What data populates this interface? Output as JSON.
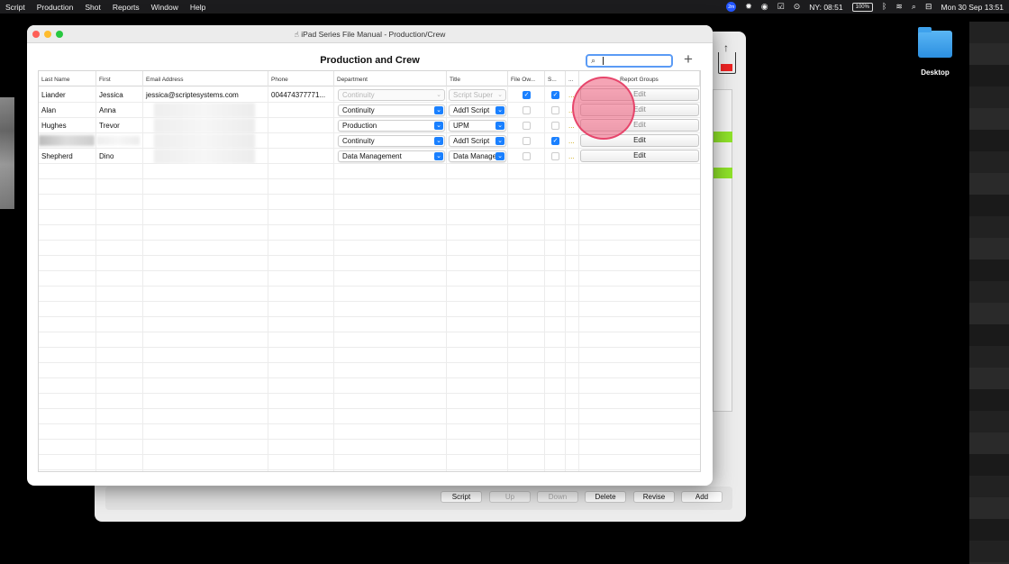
{
  "menubar": {
    "items": [
      "Script",
      "Production",
      "Shot",
      "Reports",
      "Window",
      "Help"
    ],
    "tray": {
      "badge": "2m",
      "clock_label": "NY: 08:51",
      "battery": "100%",
      "datetime": "Mon 30 Sep  13:51"
    }
  },
  "desktop": {
    "folder_label": "Desktop"
  },
  "background_window": {
    "buttons": [
      {
        "label": "Script",
        "enabled": true
      },
      {
        "label": "Up",
        "enabled": false
      },
      {
        "label": "Down",
        "enabled": false
      },
      {
        "label": "Delete",
        "enabled": true
      },
      {
        "label": "Revise",
        "enabled": true
      },
      {
        "label": "Add",
        "enabled": true
      }
    ]
  },
  "window": {
    "title": "iPad Series File Manual - Production/Crew",
    "heading": "Production and Crew",
    "search_placeholder": ""
  },
  "table": {
    "columns": [
      "Last Name",
      "First",
      "Email Address",
      "Phone",
      "Department",
      "Title",
      "File Ow...",
      "S...",
      "...",
      "Report Groups"
    ],
    "rows": [
      {
        "last": "Liander",
        "first": "Jessica",
        "email": "jessica@scriptesystems.com",
        "phone": "004474377771...",
        "department": "Continuity",
        "title": "Script Super",
        "dept_enabled": false,
        "title_enabled": false,
        "file_owner": true,
        "s": true,
        "edit": "Edit"
      },
      {
        "last": "Alan",
        "first": "Anna",
        "email": "",
        "phone": "",
        "department": "Continuity",
        "title": "Add'l Script",
        "dept_enabled": true,
        "title_enabled": true,
        "file_owner": false,
        "s": false,
        "edit": "Edit"
      },
      {
        "last": "Hughes",
        "first": "Trevor",
        "email": "",
        "phone": "",
        "department": "Production",
        "title": "UPM",
        "dept_enabled": true,
        "title_enabled": true,
        "file_owner": false,
        "s": false,
        "edit": "Edit"
      },
      {
        "last": "",
        "first": "",
        "email": "",
        "phone": "",
        "department": "Continuity",
        "title": "Add'l Script",
        "dept_enabled": true,
        "title_enabled": true,
        "file_owner": false,
        "s": true,
        "edit": "Edit"
      },
      {
        "last": "Shepherd",
        "first": "Dino",
        "email": "",
        "phone": "",
        "department": "Data Management",
        "title": "Data Manage",
        "dept_enabled": true,
        "title_enabled": true,
        "file_owner": false,
        "s": false,
        "edit": "Edit"
      }
    ],
    "ellipsis": "..."
  },
  "colors": {
    "accent": "#1a80ff",
    "click_indicator": "#ec5a78",
    "highlight_green": "#8fe32a"
  }
}
